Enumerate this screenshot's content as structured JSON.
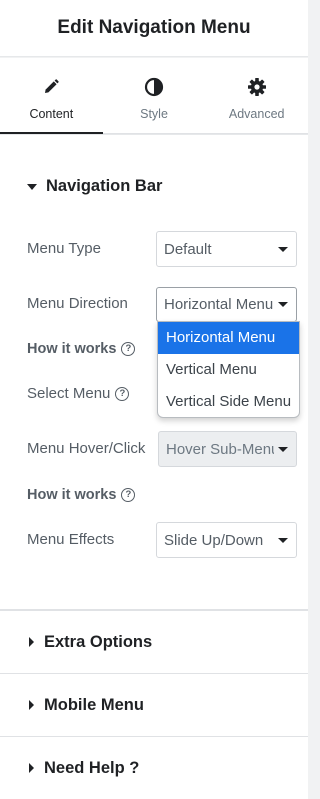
{
  "header": {
    "title": "Edit Navigation Menu"
  },
  "tabs": [
    {
      "label": "Content",
      "icon": "pencil-icon",
      "active": true
    },
    {
      "label": "Style",
      "icon": "half-circle-icon",
      "active": false
    },
    {
      "label": "Advanced",
      "icon": "gear-icon",
      "active": false
    }
  ],
  "section": {
    "title": "Navigation Bar",
    "menu_type": {
      "label": "Menu Type",
      "value": "Default"
    },
    "menu_direction": {
      "label": "Menu Direction",
      "value": "Horizontal Menu",
      "options": [
        "Horizontal Menu",
        "Vertical Menu",
        "Vertical Side Menu"
      ]
    },
    "how_it_works_1": {
      "label": "How it works",
      "icon": "?"
    },
    "select_menu": {
      "label": "Select Menu",
      "icon": "?"
    },
    "menu_hover": {
      "label": "Menu Hover/Click",
      "value": "Hover Sub-Menu"
    },
    "how_it_works_2": {
      "label": "How it works",
      "icon": "?"
    },
    "menu_effects": {
      "label": "Menu Effects",
      "value": "Slide Up/Down"
    }
  },
  "collapsed_sections": [
    "Extra Options",
    "Mobile Menu",
    "Need Help ?"
  ],
  "colors": {
    "selected_option": "#1a73e8",
    "text": "#1f2124",
    "muted": "#555d65"
  }
}
